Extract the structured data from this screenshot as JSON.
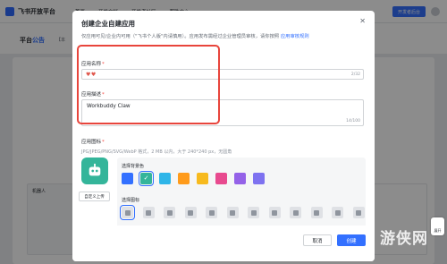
{
  "topbar": {
    "brand": "飞书开放平台",
    "nav": [
      "首页",
      "开发文档",
      "开发者社区",
      "帮助中心"
    ],
    "dev_button": "开发者后台"
  },
  "subheader": {
    "title_prefix": "平台",
    "title_highlight": "公告",
    "tag": "【本"
  },
  "background": {
    "left_card_label": "机器人"
  },
  "modal": {
    "title": "创建企业自建应用",
    "close_label": "✕",
    "description": "仅应用可见/企业内可用（\"飞书个人版\"内请慎用）。应用发布需经过企业管理员审核，请你按照 ",
    "description_link": "应用审核规则",
    "name_label": "应用名称",
    "name_value": "♥♥",
    "name_counter": "2/32",
    "desc_label": "应用描述",
    "desc_value": "Workbuddy Claw",
    "desc_counter": "14/100",
    "icon_label": "应用图标",
    "icon_hint": "JPG/JPEG/PNG/SVG/WebP 格式，2 MB 以内，大于 240*240 px，无圆角",
    "custom_upload_label": "自定义上传",
    "color_label": "选择背景色",
    "icon_select_label": "选择图标",
    "colors": [
      "#3370ff",
      "#34b59a",
      "#2eb5e8",
      "#ff9b1b",
      "#f7ba1e",
      "#e84a8f",
      "#9462e8",
      "#7e72f0"
    ],
    "selected_color_index": 1,
    "icon_names": [
      "bot-icon",
      "chat-icon",
      "robot-face-icon",
      "box-icon",
      "face-icon",
      "calendar-icon",
      "document-icon",
      "bag-icon",
      "gear-icon",
      "star-icon",
      "tool-icon",
      "grid-icon"
    ],
    "selected_icon_index": 0,
    "cancel_label": "取消",
    "create_label": "创建"
  },
  "overlay": {
    "watermark": "游侠网",
    "fab_label": "展开"
  }
}
